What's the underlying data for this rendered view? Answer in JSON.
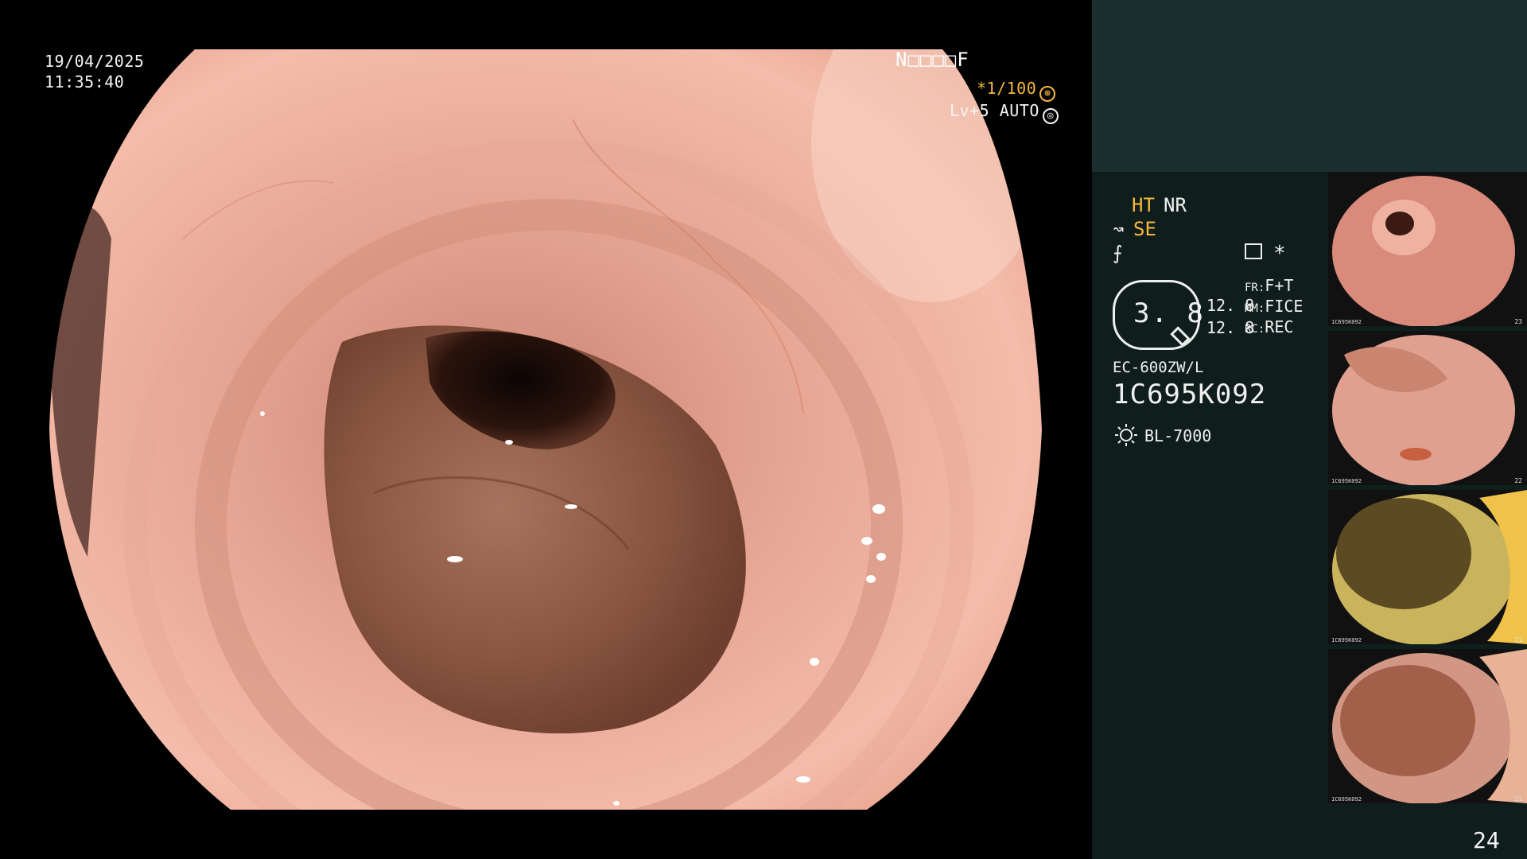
{
  "osd": {
    "date": "19/04/2025",
    "time": "11:35:40",
    "patient_code": "N□□□□F",
    "shutter": "*1/100",
    "shutter_mode": "⊛",
    "level": "Lv+5 AUTO",
    "level_mode": "◎"
  },
  "panel": {
    "ht": "HT",
    "nr": "NR",
    "se": "SE",
    "se_icon": "↝",
    "f_icon": "⨍",
    "star": "*",
    "zoom": "3. 8",
    "val1": "12. 8",
    "val2": "12. 8",
    "fr_label": "FR:",
    "fr_value": "F+T",
    "mm_label": "MM:",
    "mm_value": "FICE",
    "rc_label": "RC:",
    "rc_value": "REC",
    "scope_model": "EC-600ZW/L",
    "scope_serial": "1C695K092",
    "light_source": "BL-7000"
  },
  "thumbnails": [
    {
      "number": "23",
      "scope_id": "1C695K092",
      "tint": "#d98a7a",
      "lumen": "#3a1a12"
    },
    {
      "number": "22",
      "scope_id": "1C695K092",
      "tint": "#e0a090",
      "lumen": "#c98570"
    },
    {
      "number": "21",
      "scope_id": "1C695K092",
      "tint": "#c9b35c",
      "lumen": "#5b4a22"
    },
    {
      "number": "21",
      "scope_id": "1C695K092",
      "tint": "#d29684",
      "lumen": "#a2604a"
    }
  ],
  "page_number": "24",
  "colors": {
    "accent": "#f5b83c",
    "panel_top": "#1b302e",
    "panel_body": "#0f1e1c"
  }
}
